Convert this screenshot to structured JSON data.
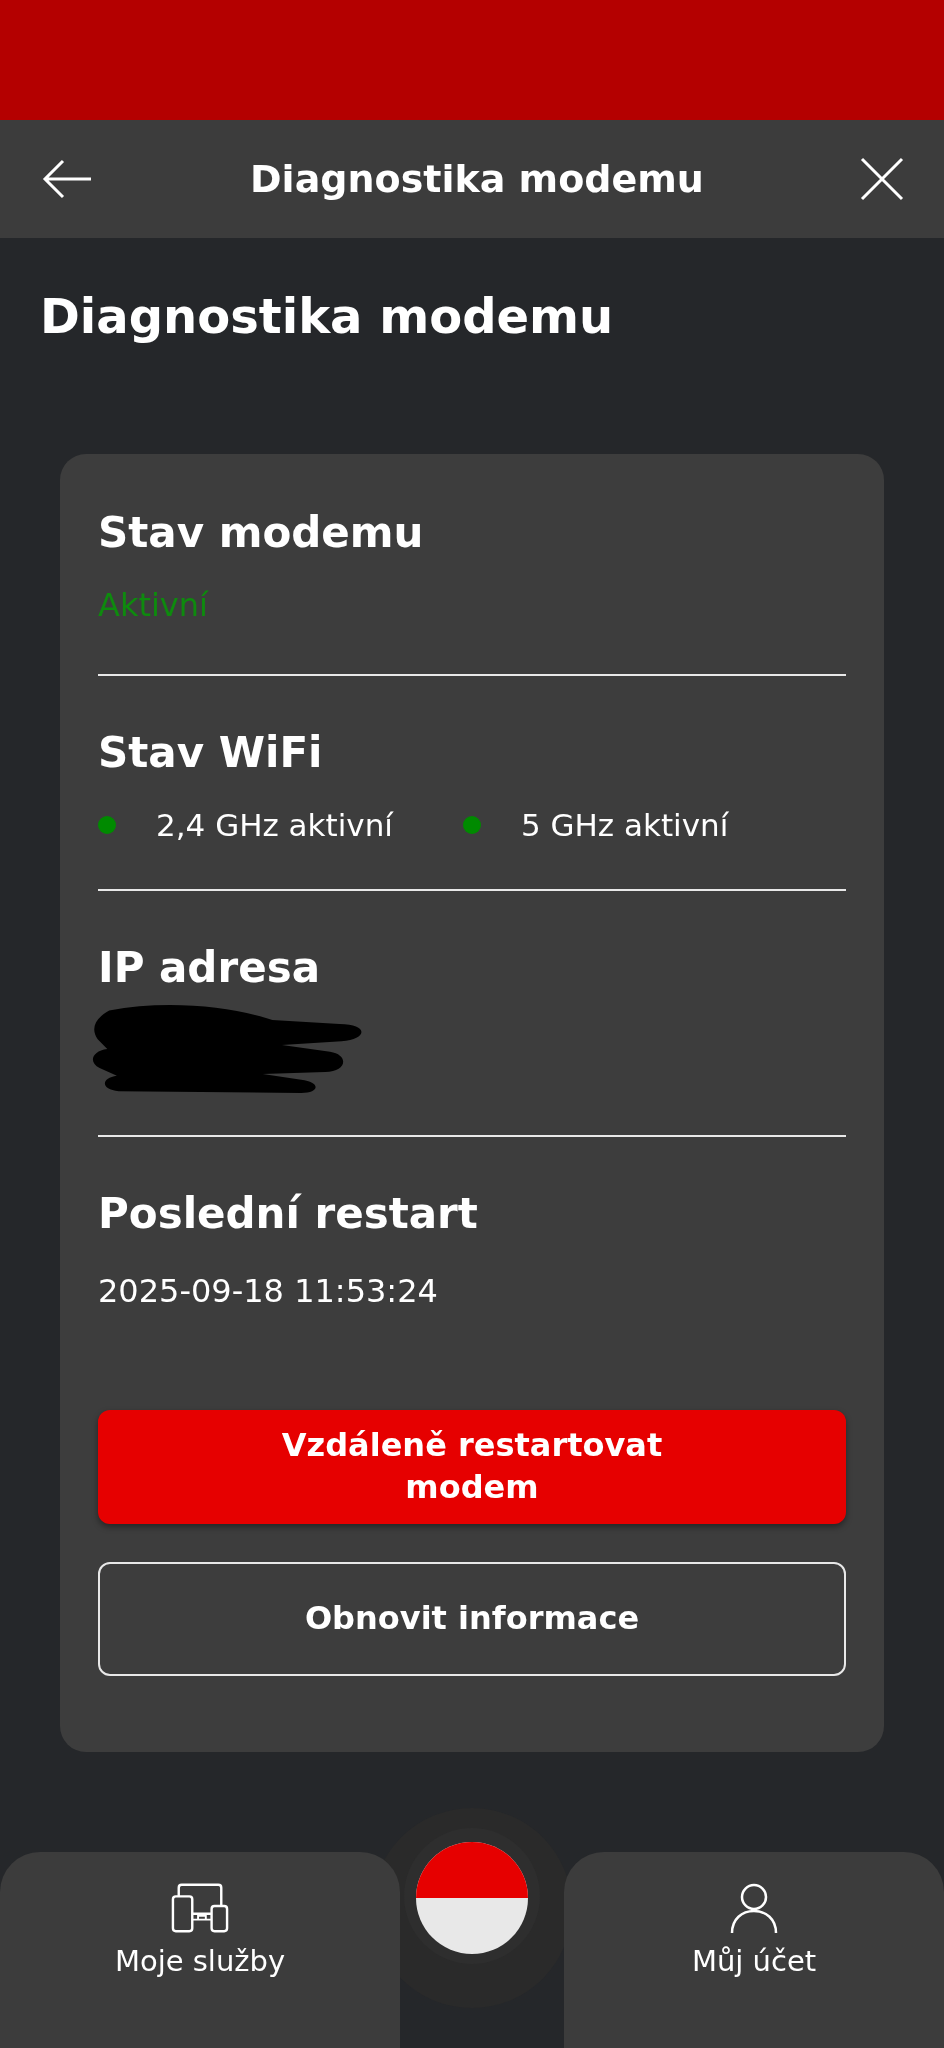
{
  "header": {
    "title": "Diagnostika modemu"
  },
  "page_title": "Diagnostika modemu",
  "card": {
    "sections": [
      {
        "kind": "status",
        "heading": "Stav modemu",
        "value": "Aktivní"
      },
      {
        "kind": "indicators",
        "heading": "Stav WiFi",
        "items": [
          {
            "label": "2,4 GHz aktivní",
            "color": "#008a00"
          },
          {
            "label": "5 GHz aktivní",
            "color": "#008a00"
          }
        ]
      },
      {
        "kind": "redacted",
        "heading": "IP adresa"
      },
      {
        "kind": "text",
        "heading": "Poslední restart",
        "value": "2025-09-18 11:53:24"
      }
    ],
    "buttons": [
      {
        "kind": "primary",
        "label": "Vzdáleně restartovat modem"
      },
      {
        "kind": "secondary",
        "label": "Obnovit informace"
      }
    ]
  },
  "bottom_nav": [
    {
      "kind": "services",
      "label": "Moje služby"
    },
    {
      "kind": "account",
      "label": "Můj účet"
    }
  ]
}
